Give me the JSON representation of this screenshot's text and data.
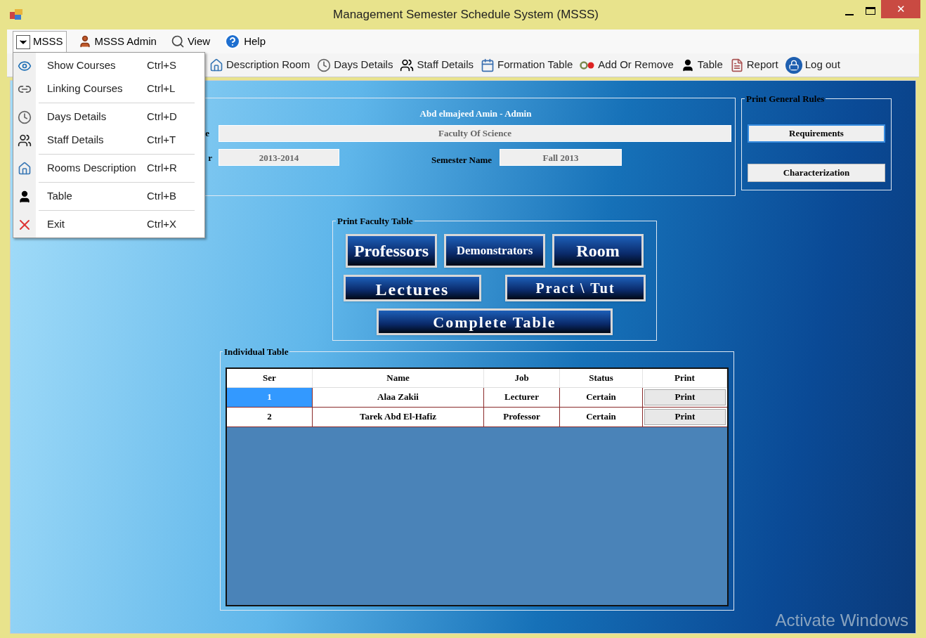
{
  "window": {
    "title": "Management Semester Schedule System (MSSS)",
    "close_label": "✕"
  },
  "menubar": [
    {
      "label": "MSSS",
      "selected": true
    },
    {
      "label": "MSSS Admin",
      "selected": false
    },
    {
      "label": "View",
      "selected": false
    },
    {
      "label": "Help",
      "selected": false
    }
  ],
  "menu": {
    "expanded": true,
    "groups": [
      [
        {
          "label": "Show Courses",
          "shortcut": "Ctrl+S"
        },
        {
          "label": "Linking Courses",
          "shortcut": "Ctrl+L"
        }
      ],
      [
        {
          "label": "Days Details",
          "shortcut": "Ctrl+D"
        },
        {
          "label": "Staff Details",
          "shortcut": "Ctrl+T"
        }
      ],
      [
        {
          "label": "Rooms Description",
          "shortcut": "Ctrl+R"
        }
      ],
      [
        {
          "label": "Table",
          "shortcut": "Ctrl+B"
        }
      ],
      [
        {
          "label": "Exit",
          "shortcut": "Ctrl+X"
        }
      ]
    ]
  },
  "toolbar": [
    "Description Room",
    "Days Details",
    "Staff Details",
    "Formation Table",
    "Add Or Remove",
    "Table",
    "Report",
    "Log out"
  ],
  "user_panel": {
    "user": "Abd elmajeed Amin - Admin",
    "label_1": "e",
    "faculty": "Faculty Of Science",
    "label_2": "r",
    "year": "2013-2014",
    "semester_label": "Semester Name",
    "semester": "Fall 2013"
  },
  "general_rules": {
    "title": "Print General Rules",
    "buttons": [
      "Requirements",
      "Characterization"
    ]
  },
  "faculty_table": {
    "title": "Print Faculty Table",
    "buttons": [
      "Professors",
      "Demonstrators",
      "Room",
      "Lectures",
      "Pract \\ Tut",
      "Complete Table"
    ]
  },
  "individual_table": {
    "title": "Individual Table",
    "columns": [
      "Ser",
      "Name",
      "Job",
      "Status",
      "Print"
    ],
    "rows": [
      {
        "ser": "1",
        "name": "Alaa Zakii",
        "job": "Lecturer",
        "status": "Certain",
        "action": "Print",
        "selected": true
      },
      {
        "ser": "2",
        "name": "Tarek Abd El-Hafiz",
        "job": "Professor",
        "status": "Certain",
        "action": "Print",
        "selected": false
      }
    ]
  },
  "os_notice": "Activate Windows"
}
